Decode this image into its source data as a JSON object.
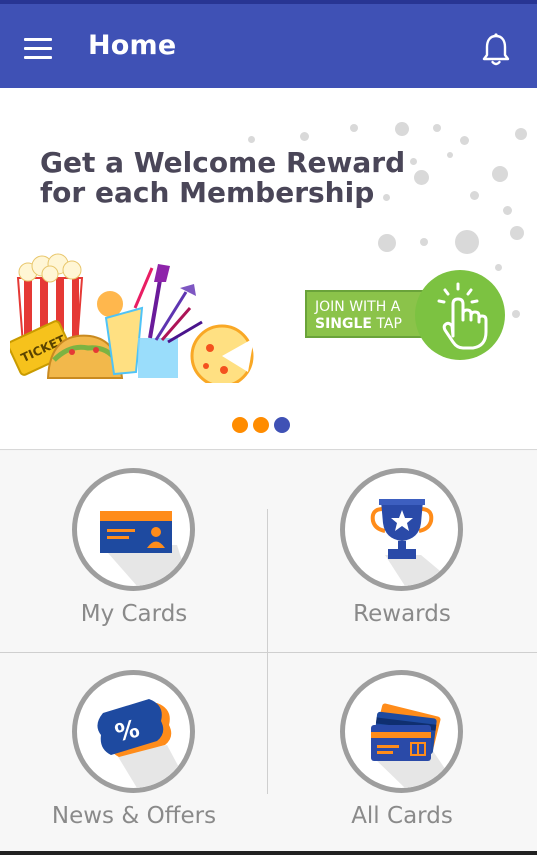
{
  "appbar": {
    "title": "Home",
    "menu_icon": "hamburger-menu-icon",
    "notification_icon": "bell-icon",
    "color": "#3f51b5"
  },
  "banner": {
    "headline_line1": "Get a Welcome Reward",
    "headline_line2": "for each Membership",
    "cta_line1": "JOIN WITH A",
    "cta_line2_bold": "SINGLE",
    "cta_line2_rest": " TAP",
    "ticket_text": "TICKET",
    "pager": {
      "count": 3,
      "active_index": 2,
      "active_color": "#3f51b5",
      "inactive_color": "#ff8c00"
    }
  },
  "tiles": [
    {
      "label": "My Cards",
      "icon": "id-card-icon"
    },
    {
      "label": "Rewards",
      "icon": "trophy-icon"
    },
    {
      "label": "News & Offers",
      "icon": "discount-tag-icon",
      "icon_text": "%"
    },
    {
      "label": "All Cards",
      "icon": "credit-cards-icon"
    }
  ]
}
